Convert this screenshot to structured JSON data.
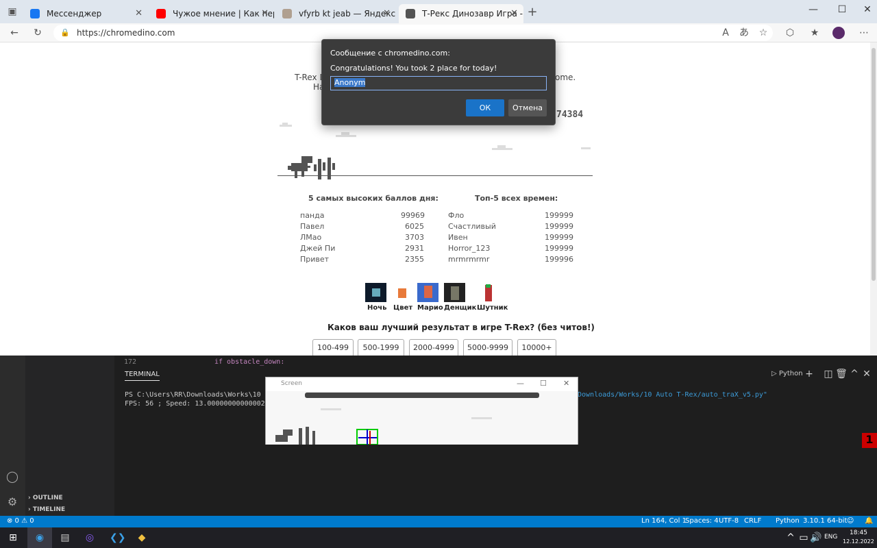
{
  "browser": {
    "tabs": [
      {
        "title": "Мессенджер",
        "icon": "messenger-icon",
        "color": "#1877f2"
      },
      {
        "title": "Чужое мнение | Как перестать",
        "icon": "youtube-icon",
        "color": "#ff0000"
      },
      {
        "title": "vfyrb kt jeab — Яндекс: нашлось",
        "icon": "yandex-icon",
        "color": "#b0a090"
      },
      {
        "title": "Т-Рекс Динозавр Игра - Хром Д",
        "icon": "dino-icon",
        "color": "#535353"
      }
    ],
    "url": "https://chromedino.com"
  },
  "page": {
    "intro_line1": "T-Rex D",
    "intro_line1_end": "ome.",
    "intro_line2": "Ha",
    "score": "74384",
    "daily_title": "5 самых высоких баллов дня:",
    "alltime_title": "Топ-5 всех времен:",
    "daily": [
      {
        "name": "панда",
        "score": "99969"
      },
      {
        "name": "Павел",
        "score": "6025"
      },
      {
        "name": "ЛМао",
        "score": "3703"
      },
      {
        "name": "Джей Пи",
        "score": "2931"
      },
      {
        "name": "Привет",
        "score": "2355"
      }
    ],
    "alltime": [
      {
        "name": "Фло",
        "score": "199999"
      },
      {
        "name": "Счастливый",
        "score": "199999"
      },
      {
        "name": "Ивен",
        "score": "199999"
      },
      {
        "name": "Horror_123",
        "score": "199999"
      },
      {
        "name": "mrmrmrmr",
        "score": "199996"
      }
    ],
    "skins": [
      "Ночь",
      "Цвет",
      "Марио",
      "Денщик",
      "Шутник"
    ],
    "question": "Каков ваш лучший результат в игре T-Rex? (без читов!)",
    "answers": [
      "100-499",
      "500-1999",
      "2000-4999",
      "5000-9999",
      "10000+"
    ]
  },
  "dialog": {
    "title": "Сообщение с chromedino.com:",
    "message": "Congratulations! You took 2 place for today!",
    "input_value": "Anonym",
    "ok": "ОК",
    "cancel": "Отмена"
  },
  "vscode": {
    "line_no": "172",
    "code": "if obstacle_down:",
    "terminal_tab": "TERMINAL",
    "terminal_line1": "PS C:\\Users\\RR\\Downloads\\Works\\10 Auto",
    "terminal_line1_end": "Downloads/Works/10 Auto T-Rex/auto_traX_v5.py\"",
    "terminal_line2": "FPS: 56 ; Speed: 13.000000000000028",
    "shell": "Python",
    "outline": "OUTLINE",
    "timeline": "TIMELINE",
    "screen_title": "Screen",
    "status": {
      "problems": "⊗ 0 ⚠ 0",
      "position": "Ln 164, Col 1",
      "spaces": "Spaces: 4",
      "encoding": "UTF-8",
      "eol": "CRLF",
      "language": "Python",
      "version": "3.10.1 64-bit"
    }
  },
  "taskbar": {
    "lang": "ENG",
    "time": "18:45",
    "date": "12.12.2022"
  }
}
